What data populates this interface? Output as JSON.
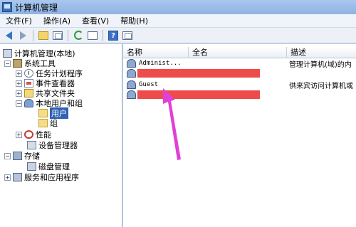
{
  "window": {
    "title": "计算机管理"
  },
  "menu": [
    "文件(F)",
    "操作(A)",
    "查看(V)",
    "帮助(H)"
  ],
  "toolbar": {
    "icons": [
      "back-arrow",
      "forward-arrow",
      "up-folder",
      "show-hide-tree",
      "refresh",
      "export-list",
      "help",
      "properties"
    ]
  },
  "tree": {
    "root": "计算机管理(本地)",
    "system_tools": "系统工具",
    "task_scheduler": "任务计划程序",
    "event_viewer": "事件查看器",
    "shared_folders": "共享文件夹",
    "local_users": "本地用户和组",
    "users": "用户",
    "groups": "组",
    "performance": "性能",
    "device_manager": "设备管理器",
    "storage": "存储",
    "disk_management": "磁盘管理",
    "services": "服务和应用程序"
  },
  "list": {
    "headers": {
      "name": "名称",
      "fullname": "全名",
      "description": "描述"
    },
    "rows": [
      {
        "name": "Administ...",
        "fullname": "",
        "description": "管理计算机(域)的内"
      },
      {
        "name": "",
        "fullname": "",
        "description": "",
        "redacted": true
      },
      {
        "name": "Guest",
        "fullname": "",
        "description": "供来宾访问计算机或"
      },
      {
        "name": "",
        "fullname": "",
        "description": "",
        "redacted": true
      }
    ]
  },
  "colors": {
    "annotation_arrow": "#e040d8",
    "redaction": "#ee4b4b",
    "selection": "#2f62b5"
  }
}
